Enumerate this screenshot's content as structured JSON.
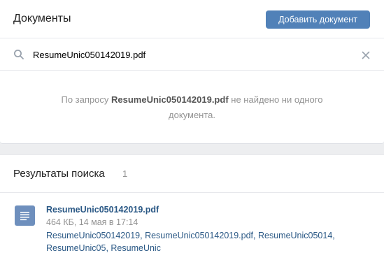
{
  "header": {
    "title": "Документы",
    "add_button": "Добавить документ"
  },
  "search": {
    "value": "ResumeUnic050142019.pdf",
    "placeholder": ""
  },
  "empty_state": {
    "prefix": "По запросу ",
    "query": "ResumeUnic050142019.pdf",
    "suffix": " не найдено ни одного документа."
  },
  "results": {
    "title": "Результаты поиска",
    "count": "1",
    "items": [
      {
        "name": "ResumeUnic050142019.pdf",
        "meta": "464 КБ, 14 мая в 17:14",
        "tags": "ResumeUnic050142019, ResumeUnic050142019.pdf, ResumeUnic05014, ResumeUnic05, ResumeUnic",
        "icon": "document-icon"
      }
    ]
  },
  "colors": {
    "accent": "#5181b8",
    "link": "#2a5885",
    "muted": "#939393",
    "page_bg": "#edeef0",
    "doc_icon": "#6e8fbd"
  },
  "icons": {
    "search": "search-icon",
    "clear": "close-icon",
    "document": "document-icon"
  }
}
